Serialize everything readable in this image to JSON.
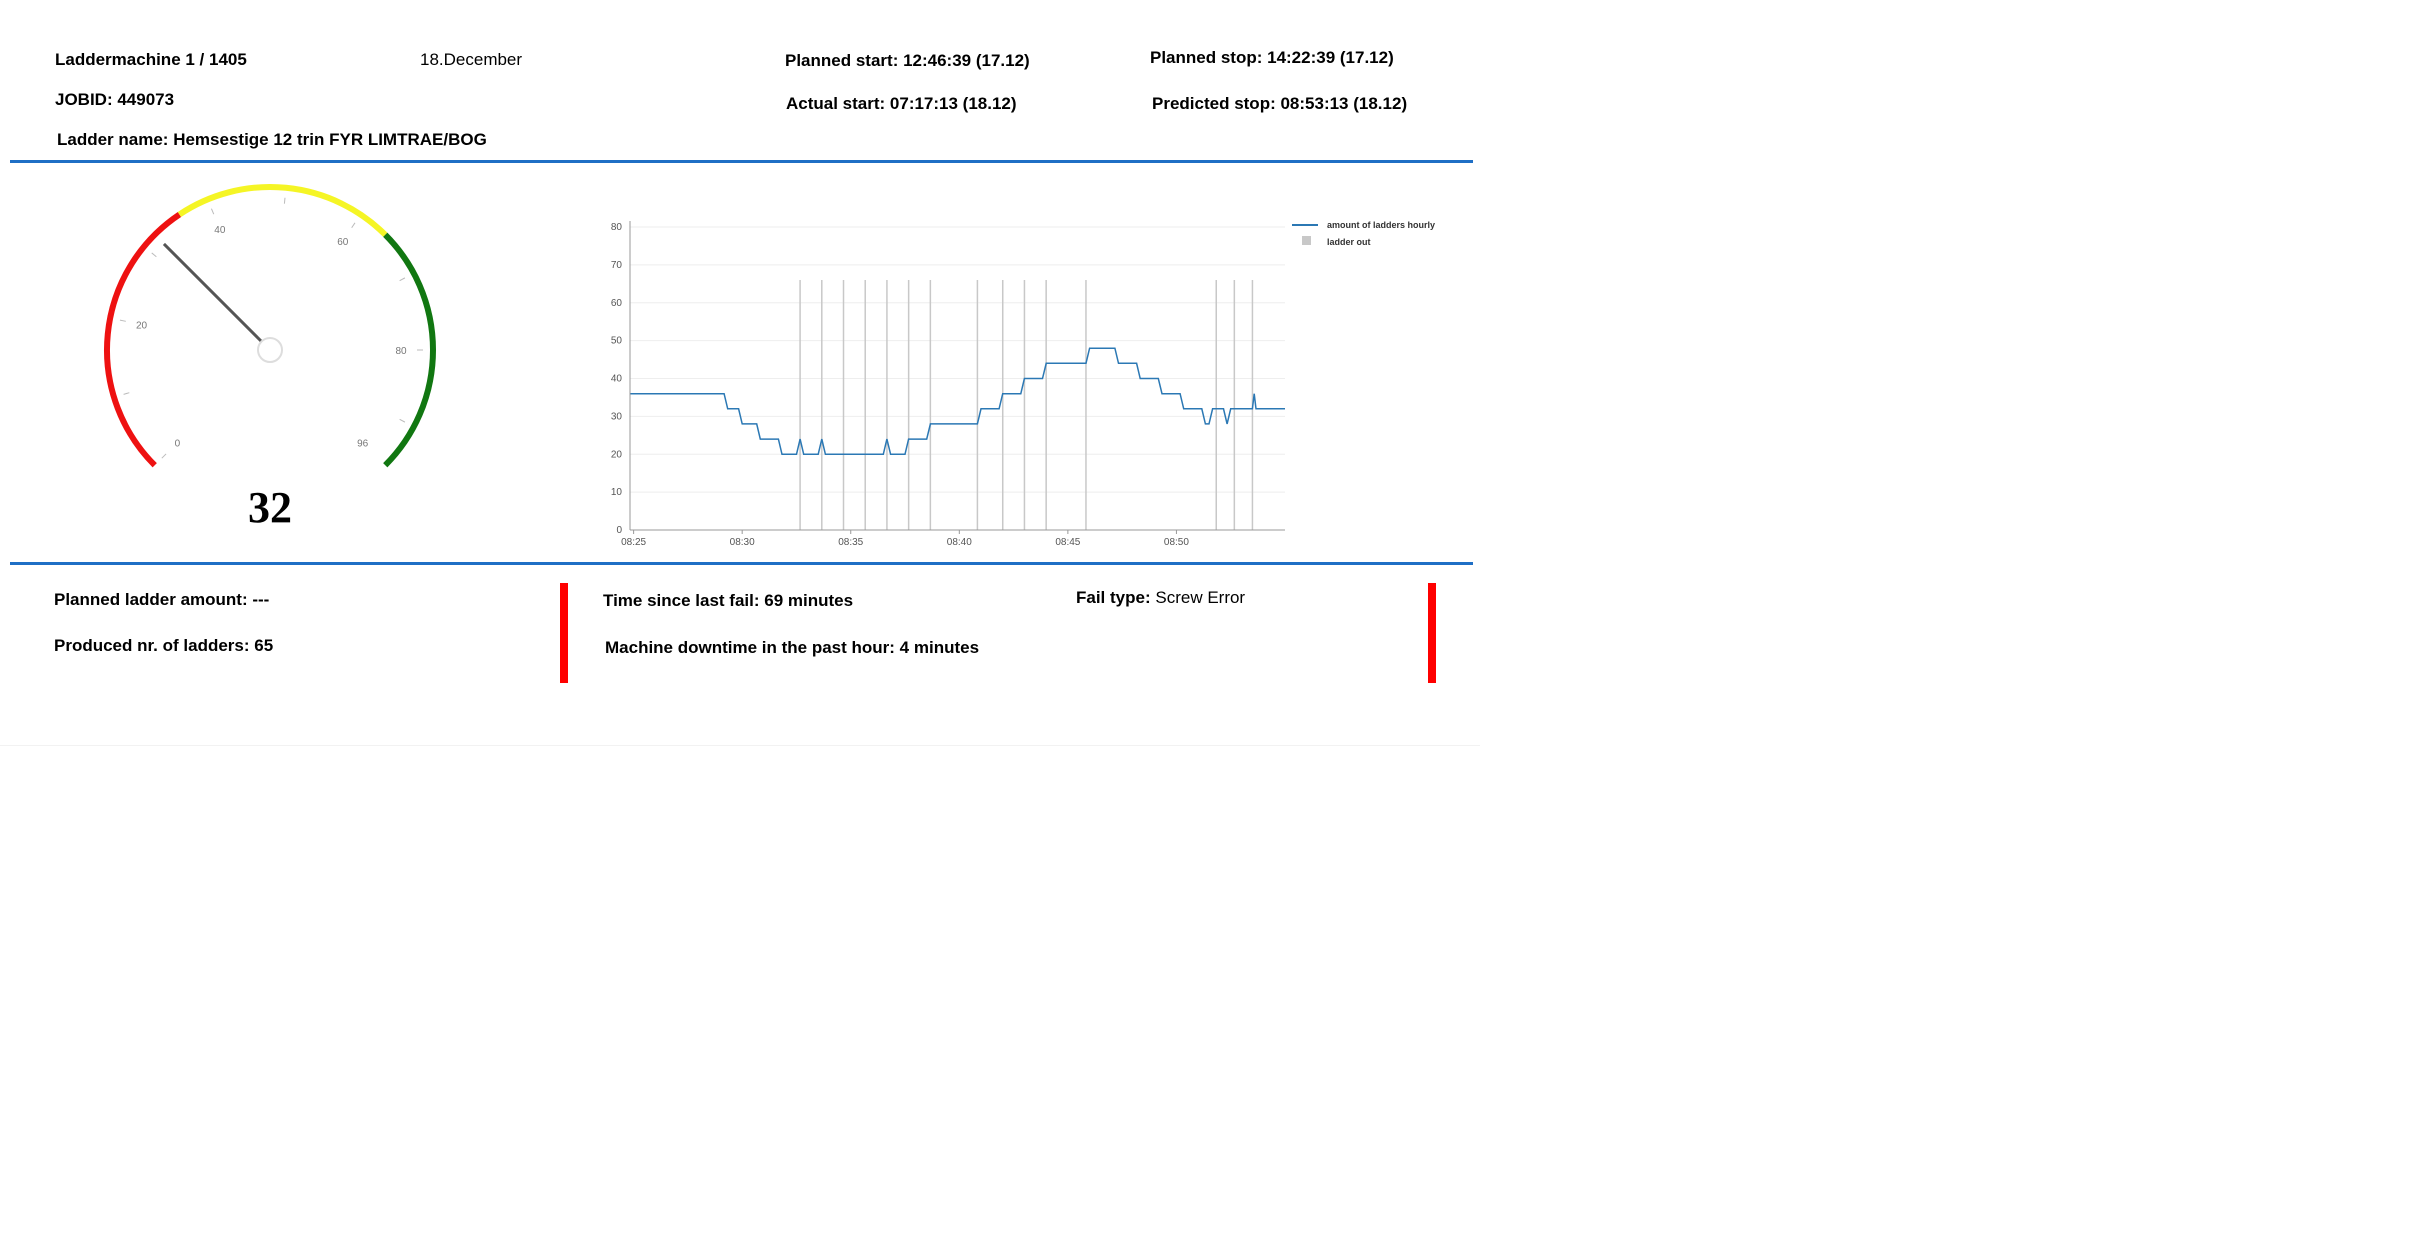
{
  "header": {
    "machine": "Laddermachine 1 / 1405",
    "date": "18.December",
    "planned_start": "Planned start: 12:46:39 (17.12)",
    "planned_stop": "Planned stop: 14:22:39 (17.12)",
    "jobid": "JOBID: 449073",
    "actual_start": "Actual start: 07:17:13 (18.12)",
    "predicted_stop": "Predicted stop: 08:53:13 (18.12)",
    "ladder_name": "Ladder name: Hemsestige 12 trin FYR LIMTRAE/BOG"
  },
  "gauge": {
    "value": 32,
    "display": "32",
    "min": 0,
    "max": 96,
    "tick_labels": [
      "0",
      "20",
      "40",
      "60",
      "80",
      "96"
    ],
    "bands": [
      {
        "from": 0,
        "to": 36,
        "color": "#ee1111"
      },
      {
        "from": 36,
        "to": 64,
        "color": "#f5f525"
      },
      {
        "from": 64,
        "to": 96,
        "color": "#117711"
      }
    ]
  },
  "chart_data": {
    "type": "line",
    "xlabel": "",
    "ylabel": "",
    "ylim": [
      0,
      80
    ],
    "yticks": [
      "0",
      "10",
      "20",
      "30",
      "40",
      "50",
      "60",
      "70",
      "80"
    ],
    "xticks": [
      "08:25",
      "08:30",
      "08:35",
      "08:40",
      "08:45",
      "08:50"
    ],
    "xlim": [
      "08:24:50",
      "08:55:00"
    ],
    "grid": true,
    "legend_position": "top-right",
    "series": [
      {
        "name": "amount of ladders hourly",
        "color": "#2b78b4",
        "points": [
          [
            "08:24:50",
            36
          ],
          [
            "08:29:10",
            36
          ],
          [
            "08:29:20",
            32
          ],
          [
            "08:29:50",
            32
          ],
          [
            "08:30:00",
            28
          ],
          [
            "08:30:40",
            28
          ],
          [
            "08:30:50",
            24
          ],
          [
            "08:31:40",
            24
          ],
          [
            "08:31:50",
            20
          ],
          [
            "08:32:30",
            20
          ],
          [
            "08:32:40",
            24
          ],
          [
            "08:32:50",
            20
          ],
          [
            "08:33:30",
            20
          ],
          [
            "08:33:40",
            24
          ],
          [
            "08:33:50",
            20
          ],
          [
            "08:36:30",
            20
          ],
          [
            "08:36:40",
            24
          ],
          [
            "08:36:50",
            20
          ],
          [
            "08:37:30",
            20
          ],
          [
            "08:37:40",
            24
          ],
          [
            "08:38:30",
            24
          ],
          [
            "08:38:40",
            28
          ],
          [
            "08:40:50",
            28
          ],
          [
            "08:41:00",
            32
          ],
          [
            "08:41:50",
            32
          ],
          [
            "08:42:00",
            36
          ],
          [
            "08:42:50",
            36
          ],
          [
            "08:43:00",
            40
          ],
          [
            "08:43:50",
            40
          ],
          [
            "08:44:00",
            44
          ],
          [
            "08:45:50",
            44
          ],
          [
            "08:46:00",
            48
          ],
          [
            "08:47:10",
            48
          ],
          [
            "08:47:20",
            44
          ],
          [
            "08:48:10",
            44
          ],
          [
            "08:48:20",
            40
          ],
          [
            "08:49:10",
            40
          ],
          [
            "08:49:20",
            36
          ],
          [
            "08:50:10",
            36
          ],
          [
            "08:50:20",
            32
          ],
          [
            "08:51:10",
            32
          ],
          [
            "08:51:20",
            28
          ],
          [
            "08:51:30",
            28
          ],
          [
            "08:51:40",
            32
          ],
          [
            "08:52:10",
            32
          ],
          [
            "08:52:20",
            28
          ],
          [
            "08:52:30",
            32
          ],
          [
            "08:53:30",
            32
          ],
          [
            "08:53:35",
            36
          ],
          [
            "08:53:40",
            32
          ],
          [
            "08:55:00",
            32
          ]
        ]
      },
      {
        "name": "ladder out",
        "color": "#c8c8c8",
        "height": 66,
        "events": [
          "08:32:40",
          "08:33:40",
          "08:34:40",
          "08:35:40",
          "08:36:40",
          "08:37:40",
          "08:38:40",
          "08:40:50",
          "08:42:00",
          "08:43:00",
          "08:44:00",
          "08:45:50",
          "08:51:50",
          "08:52:40",
          "08:53:30"
        ]
      }
    ]
  },
  "footer": {
    "planned_amount": "Planned ladder amount: ---",
    "produced": "Produced nr. of ladders: 65",
    "time_since_fail": "Time since last fail: 69 minutes",
    "downtime": "Machine downtime in the past hour: 4 minutes",
    "fail_type_label": "Fail type:",
    "fail_type_value": "Screw Error",
    "indicator_color": "#ff0000"
  }
}
